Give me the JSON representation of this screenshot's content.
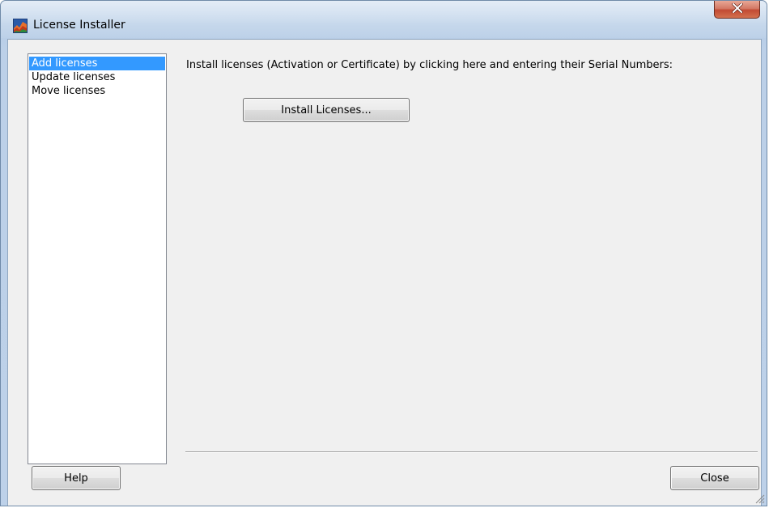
{
  "window": {
    "title": "License Installer",
    "close_glyph": "X",
    "icon_name": "app-chart-icon"
  },
  "sidebar": {
    "items": [
      {
        "label": "Add licenses",
        "selected": true
      },
      {
        "label": "Update licenses",
        "selected": false
      },
      {
        "label": "Move licenses",
        "selected": false
      }
    ]
  },
  "main": {
    "instruction": "Install licenses (Activation or Certificate) by clicking here and entering their Serial Numbers:",
    "install_button": "Install Licenses..."
  },
  "footer": {
    "help_button": "Help",
    "close_button": "Close"
  },
  "colors": {
    "selection": "#3399ff",
    "title_close": "#c24a33"
  }
}
